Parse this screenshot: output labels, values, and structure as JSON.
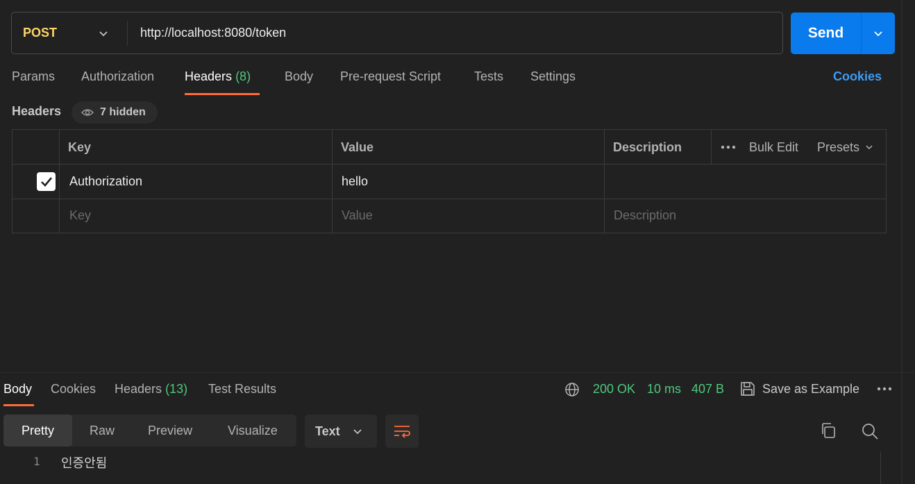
{
  "request": {
    "method": "POST",
    "url": "http://localhost:8080/token",
    "send_label": "Send"
  },
  "request_tabs": [
    {
      "label": "Params"
    },
    {
      "label": "Authorization"
    },
    {
      "label": "Headers",
      "count": "(8)"
    },
    {
      "label": "Body"
    },
    {
      "label": "Pre-request Script"
    },
    {
      "label": "Tests"
    },
    {
      "label": "Settings"
    }
  ],
  "cookies_label": "Cookies",
  "headers_section": {
    "title": "Headers",
    "hidden_label": "7 hidden"
  },
  "headers_table": {
    "columns": {
      "key": "Key",
      "value": "Value",
      "description": "Description"
    },
    "bulk_edit": "Bulk Edit",
    "presets": "Presets",
    "rows": [
      {
        "key": "Authorization",
        "value": "hello",
        "description": "",
        "checked": true
      }
    ],
    "placeholders": {
      "key": "Key",
      "value": "Value",
      "description": "Description"
    }
  },
  "response_tabs": [
    {
      "label": "Body"
    },
    {
      "label": "Cookies"
    },
    {
      "label": "Headers",
      "count": "(13)"
    },
    {
      "label": "Test Results"
    }
  ],
  "response_status": {
    "status": "200 OK",
    "time": "10 ms",
    "size": "407 B",
    "save_label": "Save as Example"
  },
  "view_modes": [
    "Pretty",
    "Raw",
    "Preview",
    "Visualize"
  ],
  "format": "Text",
  "body_lines": [
    {
      "number": "1",
      "text": "인증안됨"
    }
  ],
  "colors": {
    "accent_orange": "#ff6c37",
    "send_blue": "#097bed",
    "method_yellow": "#ffd566",
    "status_green": "#4fc97e",
    "link_blue": "#3d9bf5"
  }
}
